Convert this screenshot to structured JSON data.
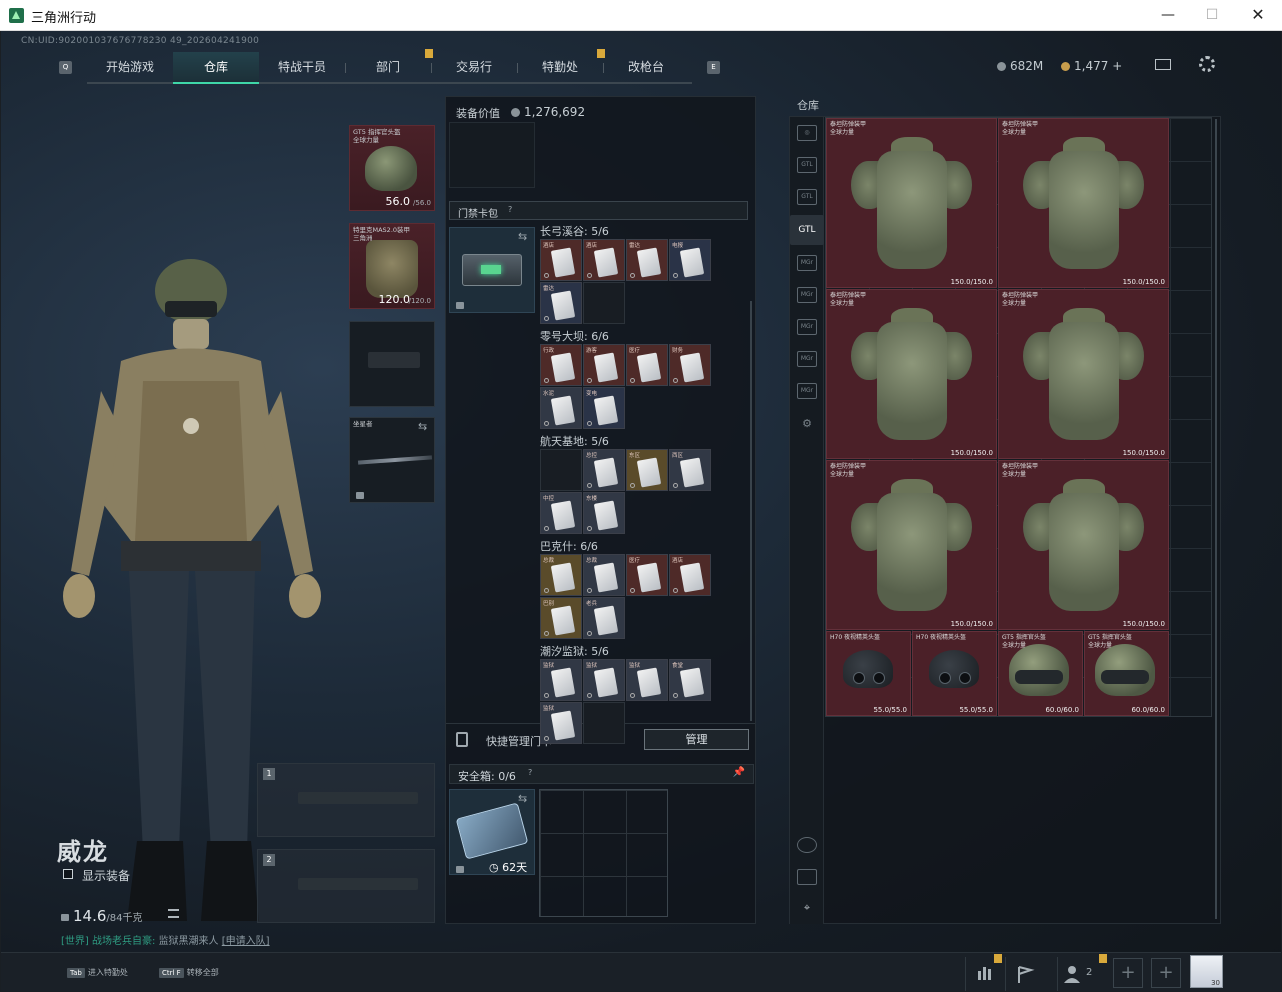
{
  "window": {
    "title": "三角洲行动",
    "min": "—",
    "max": "☐",
    "close": "✕"
  },
  "uid": "CN:UID:902001037676778230 49_202604241900",
  "nav": {
    "tabs": [
      "开始游戏",
      "仓库",
      "特战干员",
      "部门",
      "交易行",
      "特勤处",
      "改枪台"
    ],
    "active": "仓库",
    "left_key": "Q",
    "right_key": "E"
  },
  "currency": {
    "silver": "682M",
    "gold": "1,477",
    "gold_add": "+"
  },
  "operator": {
    "name": "威龙",
    "show_equipment": "显示装备",
    "weight": "14.6",
    "weight_max": "/84千克",
    "chat_channel": "[世界]",
    "chat_sender": "战场老兵自豪",
    "chat_message": "监狱黑潮来人",
    "chat_join": "[申请入队]"
  },
  "gear": {
    "helmet": {
      "label": "GT5 指挥官头盔\n全球力量",
      "durability": "56.0",
      "max": "/56.0"
    },
    "vest": {
      "label": "特里克MAS2.0装甲\n三角洲",
      "durability": "120.0",
      "max": "/120.0"
    },
    "melee": {
      "label": "坐星者"
    },
    "weapon_slot_1": "1",
    "weapon_slot_2": "2"
  },
  "equipment": {
    "title": "装备价值",
    "value": "1,276,692",
    "keycase_title": "门禁卡包",
    "keycase_help": "?",
    "maps": [
      {
        "name": "长弓溪谷: 5/6"
      },
      {
        "name": "零号大坝: 6/6"
      },
      {
        "name": "航天基地: 5/6"
      },
      {
        "name": "巴克什: 6/6"
      },
      {
        "name": "潮汐监狱: 5/6"
      }
    ],
    "card_labels": {
      "r0": [
        "酒店",
        "酒店",
        "雷达",
        "电报",
        "雷达"
      ],
      "r1": [
        "行政",
        "游客",
        "医疗",
        "财务",
        "水泥",
        "变电"
      ],
      "r2": [
        "",
        "总控",
        "东区",
        "西区",
        "中控",
        "东楼"
      ],
      "r3": [
        "总裁",
        "总裁",
        "医疗",
        "酒店",
        "巴别",
        "老兵"
      ],
      "r4": [
        "监狱",
        "监狱",
        "监狱",
        "食堂",
        "监狱"
      ]
    },
    "quick_manage": "快捷管理门卡",
    "manage_btn": "管理",
    "safe_title": "安全箱: 0/6",
    "safe_help": "?",
    "safe_days": "62天"
  },
  "warehouse": {
    "title": "仓库",
    "side_icons": [
      "◎",
      "GTL",
      "GTL",
      "GTL",
      "MGr",
      "MGr",
      "MGr",
      "MGr",
      "MGr",
      "⚙"
    ],
    "armor_label": "泰坦防弹装甲\n全球力量",
    "armor_dur": "150.0/150.0",
    "helmets": [
      {
        "label": "H70 夜视精英头盔",
        "dur": "55.0/55.0"
      },
      {
        "label": "H70 夜视精英头盔",
        "dur": "55.0/55.0"
      },
      {
        "label": "GT5 指挥官头盔\n全球力量",
        "dur": "60.0/60.0"
      },
      {
        "label": "GT5 指挥官头盔\n全球力量",
        "dur": "60.0/60.0"
      }
    ]
  },
  "bottombar": {
    "hint1_key": "Tab",
    "hint1": "进入特勤处",
    "hint2_key": "Ctrl F",
    "hint2": "转移全部",
    "friends": "2",
    "avatar_level": "30"
  }
}
